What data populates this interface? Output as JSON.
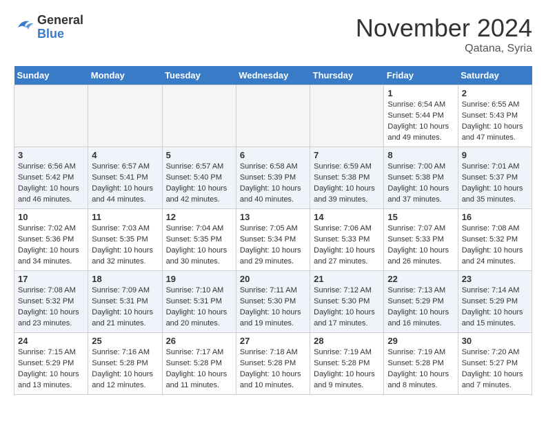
{
  "logo": {
    "line1": "General",
    "line2": "Blue"
  },
  "title": "November 2024",
  "location": "Qatana, Syria",
  "days_header": [
    "Sunday",
    "Monday",
    "Tuesday",
    "Wednesday",
    "Thursday",
    "Friday",
    "Saturday"
  ],
  "weeks": [
    [
      {
        "num": "",
        "empty": true
      },
      {
        "num": "",
        "empty": true
      },
      {
        "num": "",
        "empty": true
      },
      {
        "num": "",
        "empty": true
      },
      {
        "num": "",
        "empty": true
      },
      {
        "num": "1",
        "sunrise": "6:54 AM",
        "sunset": "5:44 PM",
        "daylight": "10 hours and 49 minutes."
      },
      {
        "num": "2",
        "sunrise": "6:55 AM",
        "sunset": "5:43 PM",
        "daylight": "10 hours and 47 minutes."
      }
    ],
    [
      {
        "num": "3",
        "sunrise": "6:56 AM",
        "sunset": "5:42 PM",
        "daylight": "10 hours and 46 minutes."
      },
      {
        "num": "4",
        "sunrise": "6:57 AM",
        "sunset": "5:41 PM",
        "daylight": "10 hours and 44 minutes."
      },
      {
        "num": "5",
        "sunrise": "6:57 AM",
        "sunset": "5:40 PM",
        "daylight": "10 hours and 42 minutes."
      },
      {
        "num": "6",
        "sunrise": "6:58 AM",
        "sunset": "5:39 PM",
        "daylight": "10 hours and 40 minutes."
      },
      {
        "num": "7",
        "sunrise": "6:59 AM",
        "sunset": "5:38 PM",
        "daylight": "10 hours and 39 minutes."
      },
      {
        "num": "8",
        "sunrise": "7:00 AM",
        "sunset": "5:38 PM",
        "daylight": "10 hours and 37 minutes."
      },
      {
        "num": "9",
        "sunrise": "7:01 AM",
        "sunset": "5:37 PM",
        "daylight": "10 hours and 35 minutes."
      }
    ],
    [
      {
        "num": "10",
        "sunrise": "7:02 AM",
        "sunset": "5:36 PM",
        "daylight": "10 hours and 34 minutes."
      },
      {
        "num": "11",
        "sunrise": "7:03 AM",
        "sunset": "5:35 PM",
        "daylight": "10 hours and 32 minutes."
      },
      {
        "num": "12",
        "sunrise": "7:04 AM",
        "sunset": "5:35 PM",
        "daylight": "10 hours and 30 minutes."
      },
      {
        "num": "13",
        "sunrise": "7:05 AM",
        "sunset": "5:34 PM",
        "daylight": "10 hours and 29 minutes."
      },
      {
        "num": "14",
        "sunrise": "7:06 AM",
        "sunset": "5:33 PM",
        "daylight": "10 hours and 27 minutes."
      },
      {
        "num": "15",
        "sunrise": "7:07 AM",
        "sunset": "5:33 PM",
        "daylight": "10 hours and 26 minutes."
      },
      {
        "num": "16",
        "sunrise": "7:08 AM",
        "sunset": "5:32 PM",
        "daylight": "10 hours and 24 minutes."
      }
    ],
    [
      {
        "num": "17",
        "sunrise": "7:08 AM",
        "sunset": "5:32 PM",
        "daylight": "10 hours and 23 minutes."
      },
      {
        "num": "18",
        "sunrise": "7:09 AM",
        "sunset": "5:31 PM",
        "daylight": "10 hours and 21 minutes."
      },
      {
        "num": "19",
        "sunrise": "7:10 AM",
        "sunset": "5:31 PM",
        "daylight": "10 hours and 20 minutes."
      },
      {
        "num": "20",
        "sunrise": "7:11 AM",
        "sunset": "5:30 PM",
        "daylight": "10 hours and 19 minutes."
      },
      {
        "num": "21",
        "sunrise": "7:12 AM",
        "sunset": "5:30 PM",
        "daylight": "10 hours and 17 minutes."
      },
      {
        "num": "22",
        "sunrise": "7:13 AM",
        "sunset": "5:29 PM",
        "daylight": "10 hours and 16 minutes."
      },
      {
        "num": "23",
        "sunrise": "7:14 AM",
        "sunset": "5:29 PM",
        "daylight": "10 hours and 15 minutes."
      }
    ],
    [
      {
        "num": "24",
        "sunrise": "7:15 AM",
        "sunset": "5:29 PM",
        "daylight": "10 hours and 13 minutes."
      },
      {
        "num": "25",
        "sunrise": "7:16 AM",
        "sunset": "5:28 PM",
        "daylight": "10 hours and 12 minutes."
      },
      {
        "num": "26",
        "sunrise": "7:17 AM",
        "sunset": "5:28 PM",
        "daylight": "10 hours and 11 minutes."
      },
      {
        "num": "27",
        "sunrise": "7:18 AM",
        "sunset": "5:28 PM",
        "daylight": "10 hours and 10 minutes."
      },
      {
        "num": "28",
        "sunrise": "7:19 AM",
        "sunset": "5:28 PM",
        "daylight": "10 hours and 9 minutes."
      },
      {
        "num": "29",
        "sunrise": "7:19 AM",
        "sunset": "5:28 PM",
        "daylight": "10 hours and 8 minutes."
      },
      {
        "num": "30",
        "sunrise": "7:20 AM",
        "sunset": "5:27 PM",
        "daylight": "10 hours and 7 minutes."
      }
    ]
  ]
}
